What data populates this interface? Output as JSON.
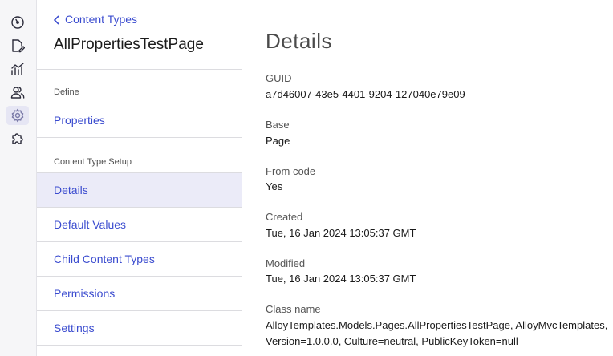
{
  "rail": {
    "icons": [
      "dashboard-icon",
      "edit-icon",
      "reports-icon",
      "users-icon",
      "settings-icon",
      "addons-icon"
    ]
  },
  "panel": {
    "back_label": "Content Types",
    "title": "AllPropertiesTestPage",
    "section_define": "Define",
    "properties_label": "Properties",
    "section_setup": "Content Type Setup",
    "nav": [
      "Details",
      "Default Values",
      "Child Content Types",
      "Permissions",
      "Settings"
    ],
    "active_item": "Details"
  },
  "details": {
    "title": "Details",
    "guid_label": "GUID",
    "guid_value": "a7d46007-43e5-4401-9204-127040e79e09",
    "base_label": "Base",
    "base_value": "Page",
    "fromcode_label": "From code",
    "fromcode_value": "Yes",
    "created_label": "Created",
    "created_value": "Tue, 16 Jan 2024 13:05:37 GMT",
    "modified_label": "Modified",
    "modified_value": "Tue, 16 Jan 2024 13:05:37 GMT",
    "classname_label": "Class name",
    "classname_value_line1": "AlloyTemplates.Models.Pages.AllPropertiesTestPage, AlloyMvcTemplates,",
    "classname_value_line2": "Version=1.0.0.0, Culture=neutral, PublicKeyToken=null"
  },
  "colors": {
    "link": "#3b4ccf",
    "active_bg": "#ebebf8",
    "rail_bg": "#f6f6f8"
  }
}
